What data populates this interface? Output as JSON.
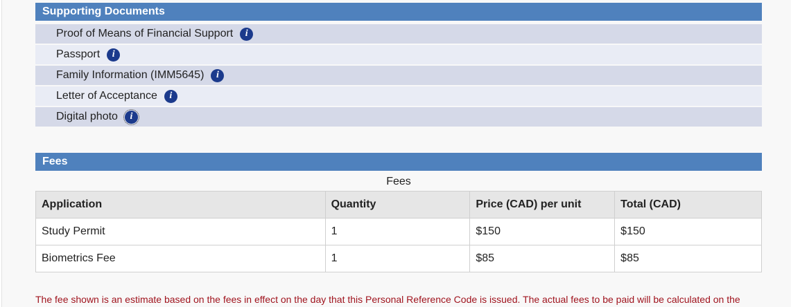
{
  "supporting_documents": {
    "title": "Supporting Documents",
    "items": [
      {
        "label": "Proof of Means of Financial Support"
      },
      {
        "label": "Passport"
      },
      {
        "label": "Family Information (IMM5645)"
      },
      {
        "label": "Letter of Acceptance"
      },
      {
        "label": "Digital photo"
      }
    ],
    "info_icon": "info-icon",
    "info_glyph": "i"
  },
  "fees": {
    "title": "Fees",
    "caption": "Fees",
    "headers": [
      "Application",
      "Quantity",
      "Price (CAD) per unit",
      "Total (CAD)"
    ],
    "rows": [
      [
        "Study Permit",
        "1",
        "$150",
        "$150"
      ],
      [
        "Biometrics Fee",
        "1",
        "$85",
        "$85"
      ]
    ],
    "note": "The fee shown is an estimate based on the fees in effect on the day that this Personal Reference Code is issued. The actual fees to be paid will be calculated on the"
  },
  "colors": {
    "header_bg": "#4f81bd",
    "row_dark": "#d5d9e8",
    "row_light": "#e9ecf5",
    "info_icon_bg": "#1b3a8c",
    "note_text": "#a0141e"
  }
}
